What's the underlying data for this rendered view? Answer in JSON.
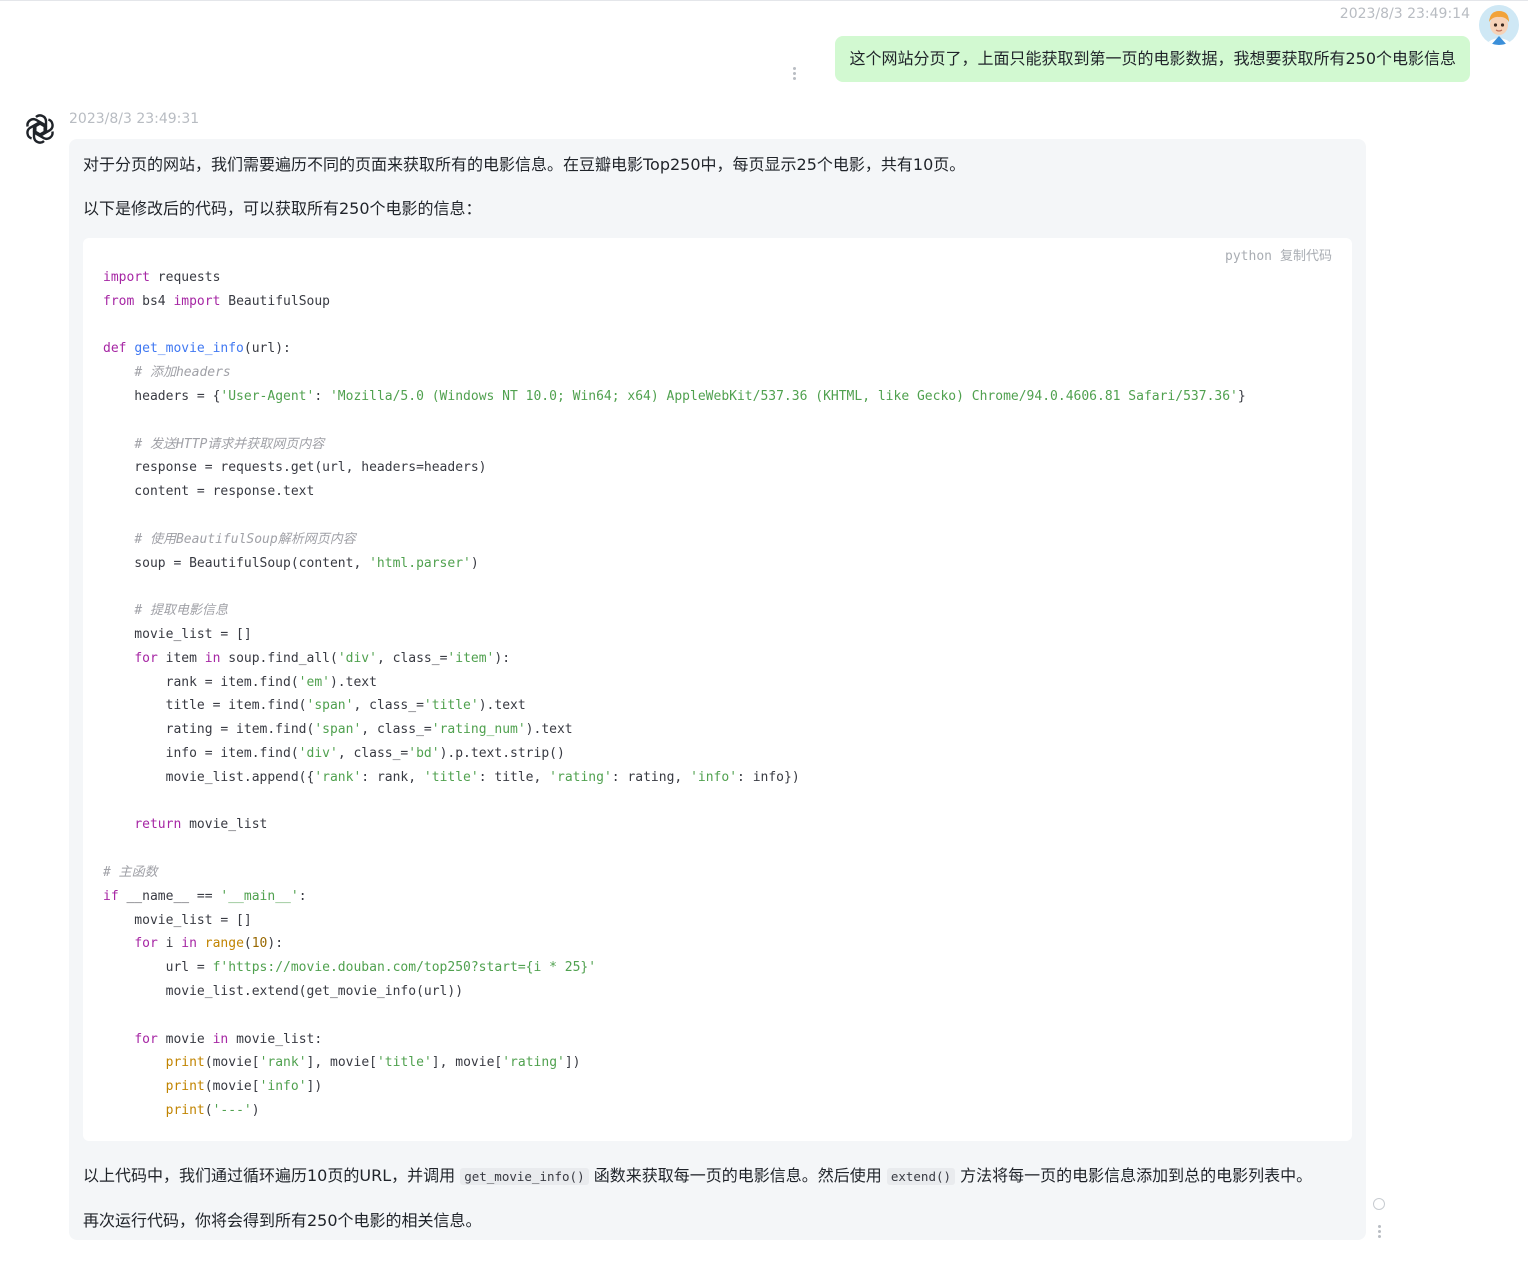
{
  "user_message": {
    "timestamp": "2023/8/3 23:49:14",
    "text": "这个网站分页了，上面只能获取到第一页的电影数据，我想要获取所有250个电影信息"
  },
  "assistant_message": {
    "timestamp": "2023/8/3 23:49:31",
    "intro_1": "对于分页的网站，我们需要遍历不同的页面来获取所有的电影信息。在豆瓣电影Top250中，每页显示25个电影，共有10页。",
    "intro_2": "以下是修改后的代码，可以获取所有250个电影的信息：",
    "code_block": {
      "language": "python",
      "copy_label": "复制代码",
      "lines": [
        "import requests",
        "from bs4 import BeautifulSoup",
        "",
        "def get_movie_info(url):",
        "    # 添加headers",
        "    headers = {'User-Agent': 'Mozilla/5.0 (Windows NT 10.0; Win64; x64) AppleWebKit/537.36 (KHTML, like Gecko) Chrome/94.0.4606.81 Safari/537.36'}",
        "",
        "    # 发送HTTP请求并获取网页内容",
        "    response = requests.get(url, headers=headers)",
        "    content = response.text",
        "",
        "    # 使用BeautifulSoup解析网页内容",
        "    soup = BeautifulSoup(content, 'html.parser')",
        "",
        "    # 提取电影信息",
        "    movie_list = []",
        "    for item in soup.find_all('div', class_='item'):",
        "        rank = item.find('em').text",
        "        title = item.find('span', class_='title').text",
        "        rating = item.find('span', class_='rating_num').text",
        "        info = item.find('div', class_='bd').p.text.strip()",
        "        movie_list.append({'rank': rank, 'title': title, 'rating': rating, 'info': info})",
        "",
        "    return movie_list",
        "",
        "# 主函数",
        "if __name__ == '__main__':",
        "    movie_list = []",
        "    for i in range(10):",
        "        url = f'https://movie.douban.com/top250?start={i * 25}'",
        "        movie_list.extend(get_movie_info(url))",
        "",
        "    for movie in movie_list:",
        "        print(movie['rank'], movie['title'], movie['rating'])",
        "        print(movie['info'])",
        "        print('---')"
      ]
    },
    "outro_1": {
      "before": "以上代码中，我们通过循环遍历10页的URL，并调用",
      "code_1": "get_movie_info()",
      "middle": "函数来获取每一页的电影信息。然后使用",
      "code_2": "extend()",
      "after": "方法将每一页的电影信息添加到总的电影列表中。"
    },
    "outro_2": "再次运行代码，你将会得到所有250个电影的相关信息。"
  },
  "colors": {
    "user_bubble": "#d2f9d1",
    "assistant_bubble": "#f4f6f8",
    "code_background": "#ffffff",
    "keyword": "#a626a4",
    "string": "#50a14f",
    "function": "#4078f2",
    "comment": "#a0a1a7"
  },
  "icons": {
    "user_avatar": "cartoon-person-avatar-icon",
    "assistant_avatar": "openai-logo-icon",
    "message_menu": "vertical-dots-icon",
    "regenerate": "circle-icon"
  }
}
